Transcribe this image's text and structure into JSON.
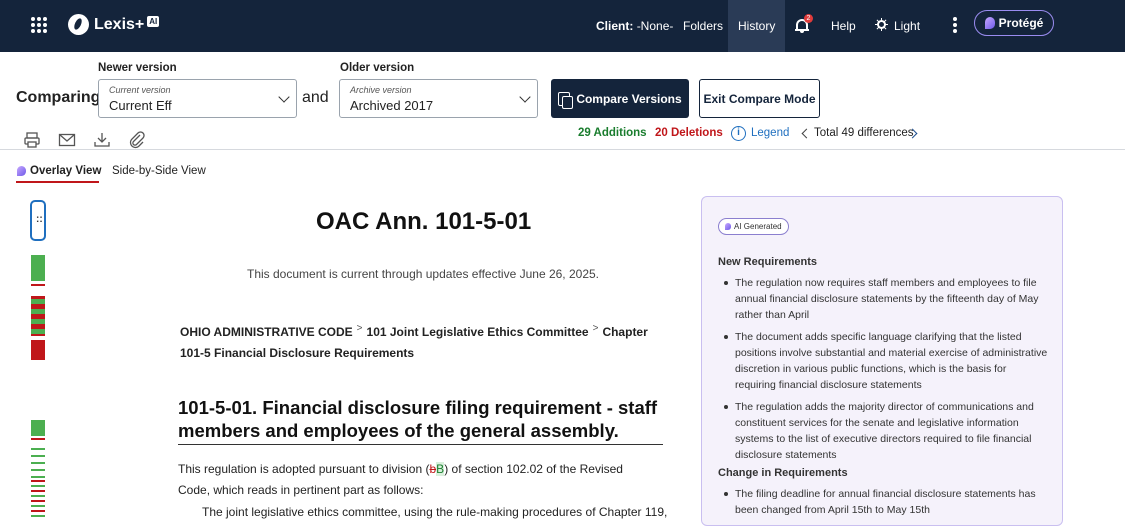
{
  "header": {
    "logo_text": "Lexis+",
    "logo_ai": "AI",
    "client_label": "Client:",
    "client_value": "-None-",
    "nav": [
      "Folders",
      "History",
      "Help",
      "Light"
    ],
    "notification_count": "2",
    "protege_label": "Protégé"
  },
  "compare": {
    "comparing_label": "Comparing",
    "newer_label": "Newer version",
    "newer_small": "Current version",
    "newer_value": "Current Eff",
    "and_label": "and",
    "older_label": "Older version",
    "older_small": "Archive version",
    "older_value": "Archived 2017",
    "compare_button": "Compare Versions",
    "exit_button": "Exit Compare Mode"
  },
  "stats": {
    "additions": "29 Additions",
    "deletions": "20 Deletions",
    "legend": "Legend",
    "total": "Total 49 differences"
  },
  "tabs": {
    "overlay": "Overlay View",
    "side_by_side": "Side-by-Side View"
  },
  "document": {
    "title": "OAC Ann. 101-5-01",
    "current_through": "This document is current through updates effective June 26, 2025.",
    "breadcrumb_1": "OHIO ADMINISTRATIVE CODE",
    "breadcrumb_2": "101 Joint Legislative Ethics Committee",
    "breadcrumb_3": "Chapter 101-5 Financial Disclosure Requirements",
    "breadcrumb_sep": ">",
    "section_heading": "101-5-01. Financial disclosure filing requirement - staff members and employees of the general assembly.",
    "para_1_before": "This regulation is adopted pursuant to division (",
    "para_1_deleted": "b",
    "para_1_inserted": "B",
    "para_1_after": ") of section 102.02 of the Revised Code, which reads in pertinent part as follows:",
    "para_2": "The joint legislative ethics committee, using the rule-making procedures of Chapter 119,"
  },
  "ai_panel": {
    "badge": "AI Generated",
    "new_heading": "New Requirements",
    "new_items": [
      "The regulation now requires staff members and employees to file annual financial disclosure statements by the fifteenth day of May rather than April",
      "The document adds specific language clarifying that the listed positions involve substantial and material exercise of administrative discretion in various public functions, which is the basis for requiring financial disclosure statements",
      "The regulation adds the majority director of communications and constituent services for the senate and legislative information systems to the list of executive directors required to file financial disclosure statements"
    ],
    "change_heading": "Change in Requirements",
    "change_items": [
      "The filing deadline for annual financial disclosure statements has been changed from April 15th to May 15th"
    ]
  },
  "colors": {
    "navy": "#14243b",
    "addition_green": "#1a7d2e",
    "deletion_red": "#c0161a",
    "link_blue": "#1f6fbf",
    "ai_purple": "#8b7fcf"
  },
  "minimap_marks": [
    {
      "color": "addition",
      "kind": "block"
    },
    {
      "color": "deletion",
      "kind": "line"
    },
    {
      "color": "addition",
      "kind": "block"
    },
    {
      "color": "deletion",
      "kind": "line"
    },
    {
      "color": "mixed",
      "kind": "block"
    },
    {
      "color": "deletion",
      "kind": "block"
    },
    {
      "color": "addition",
      "kind": "block"
    },
    {
      "color": "addition",
      "kind": "lines"
    },
    {
      "color": "deletion",
      "kind": "lines"
    }
  ]
}
